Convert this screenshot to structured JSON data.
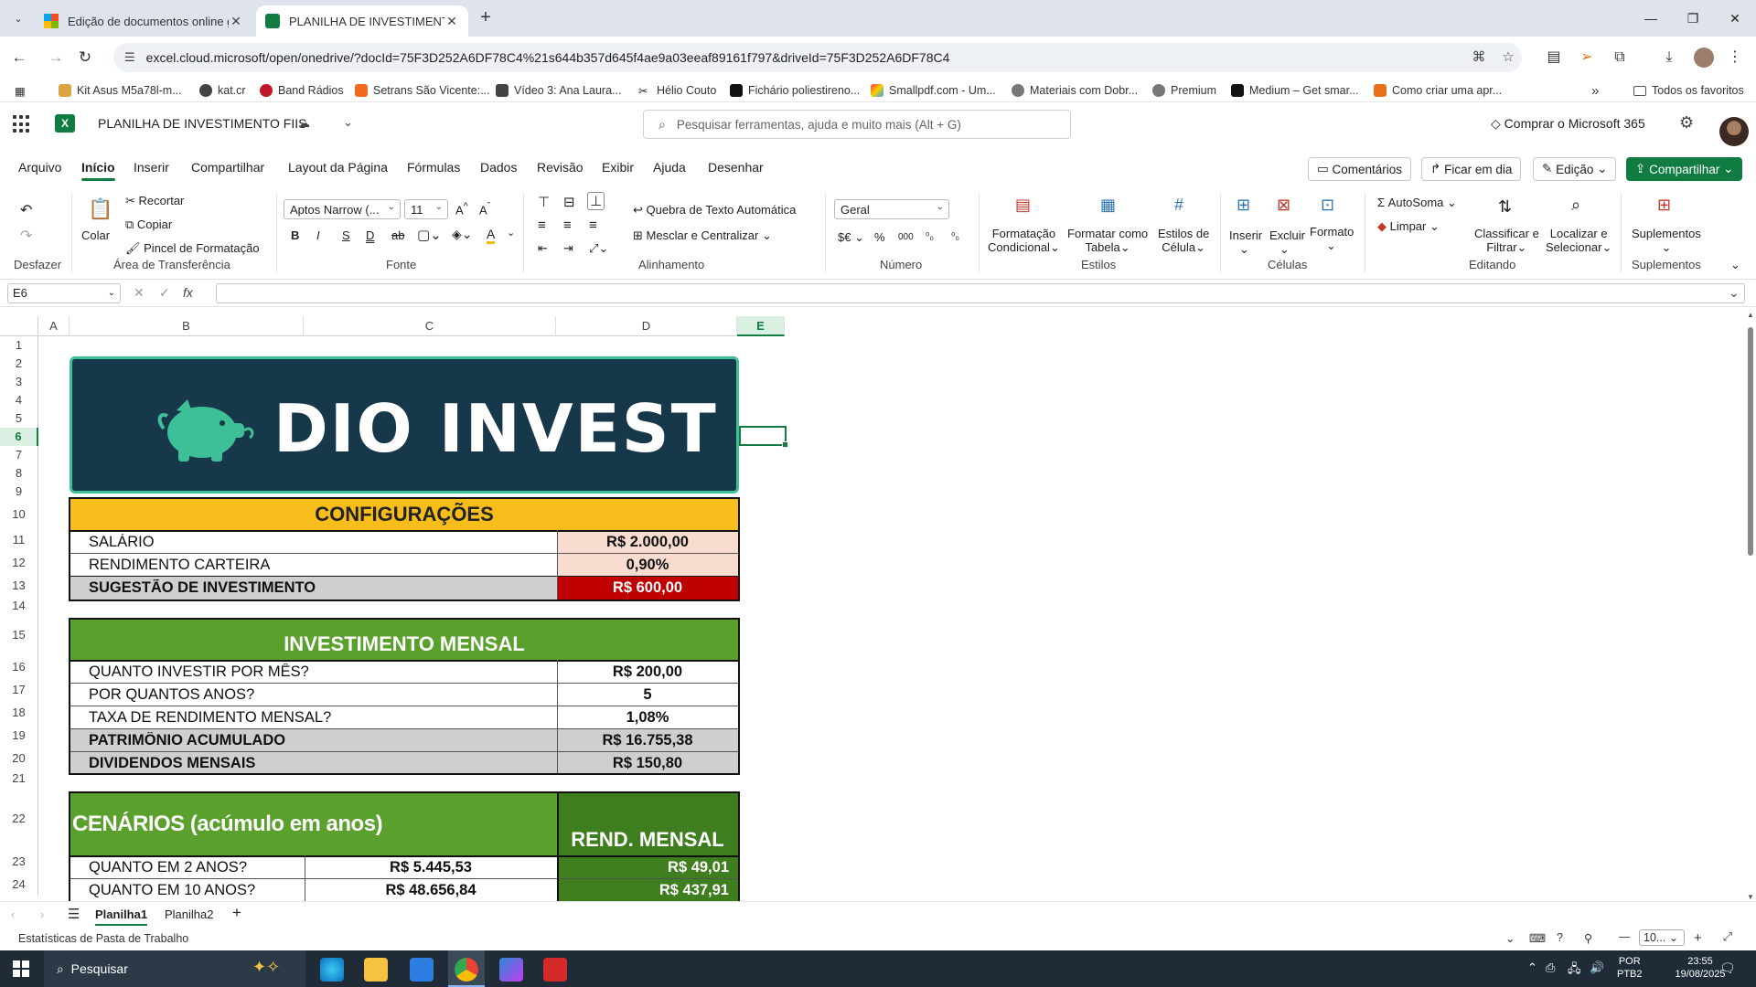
{
  "browser": {
    "tabs": [
      {
        "title": "Edição de documentos online g",
        "active": false
      },
      {
        "title": "PLANILHA DE INVESTIMENTO F",
        "active": true
      }
    ],
    "url": "excel.cloud.microsoft/open/onedrive/?docId=75F3D252A6DF78C4%21s644b357d645f4ae9a03eeaf89161f797&driveId=75F3D252A6DF78C4",
    "bookmarks": [
      "Kit Asus M5a78l-m...",
      "kat.cr",
      "Band Rádios",
      "Setrans São Vicente:...",
      "Vídeo 3: Ana Laura...",
      "Hélio Couto",
      "Fichário poliestireno...",
      "Smallpdf.com - Um...",
      "Materiais com Dobr...",
      "Premium",
      "Medium – Get smar...",
      "Como criar uma apr..."
    ],
    "bookmarks_more": "»",
    "all_favorites": "Todos os favoritos"
  },
  "excel": {
    "doc_title": "PLANILHA DE INVESTIMENTO FIIS",
    "search_placeholder": "Pesquisar ferramentas, ajuda e muito mais (Alt + G)",
    "buy": "Comprar o Microsoft 365",
    "ribbon_tabs": [
      "Arquivo",
      "Início",
      "Inserir",
      "Compartilhar",
      "Layout da Página",
      "Fórmulas",
      "Dados",
      "Revisão",
      "Exibir",
      "Ajuda",
      "Desenhar"
    ],
    "right_buttons": {
      "comments": "Comentários",
      "meeting": "Ficar em dia",
      "editing": "Edição",
      "share": "Compartilhar"
    },
    "ribbon": {
      "undo_group": "Desfazer",
      "paste": "Colar",
      "cut": "Recortar",
      "copy": "Copiar",
      "format_painter": "Pincel de Formatação",
      "clipboard_group": "Área de Transferência",
      "font_name": "Aptos Narrow (...",
      "font_size": "11",
      "font_group": "Fonte",
      "wrap": "Quebra de Texto Automática",
      "merge": "Mesclar e Centralizar",
      "align_group": "Alinhamento",
      "num_format": "Geral",
      "number_group": "Número",
      "cond_format": "Formatação",
      "cond_format2": "Condicional",
      "fmt_table": "Formatar como",
      "fmt_table2": "Tabela",
      "cell_styles": "Estilos de",
      "cell_styles2": "Célula",
      "styles_group": "Estilos",
      "insert": "Inserir",
      "delete": "Excluir",
      "format": "Formato",
      "cells_group": "Células",
      "autosum": "AutoSoma",
      "clear": "Limpar",
      "sort": "Classificar e",
      "sort2": "Filtrar",
      "find": "Localizar e",
      "find2": "Selecionar",
      "editing_group": "Editando",
      "addins": "Suplementos",
      "addins_group": "Suplementos"
    },
    "name_box": "E6",
    "columns": [
      "A",
      "B",
      "C",
      "D",
      "E"
    ],
    "selected_column": "E",
    "rows": [
      "1",
      "2",
      "3",
      "4",
      "5",
      "6",
      "7",
      "8",
      "9",
      "10",
      "11",
      "12",
      "13",
      "14",
      "15",
      "16",
      "17",
      "18",
      "19",
      "20",
      "21",
      "22",
      "23",
      "24"
    ],
    "selected_row": "6",
    "banner_title": "DIO INVEST",
    "config": {
      "header": "CONFIGURAÇÕES",
      "rows": [
        {
          "label": "SALÁRIO",
          "value": "R$ 2.000,00"
        },
        {
          "label": "RENDIMENTO CARTEIRA",
          "value": "0,90%"
        },
        {
          "label": "SUGESTÃO DE INVESTIMENTO",
          "value": "R$ 600,00"
        }
      ]
    },
    "monthly": {
      "header": "INVESTIMENTO MENSAL",
      "rows": [
        {
          "label": "QUANTO INVESTIR POR MÊS?",
          "value": "R$ 200,00"
        },
        {
          "label": "POR QUANTOS ANOS?",
          "value": "5"
        },
        {
          "label": "TAXA DE RENDIMENTO MENSAL?",
          "value": "1,08%"
        },
        {
          "label": "PATRIMÔNIO ACUMULADO",
          "value": "R$ 16.755,38"
        },
        {
          "label": "DIVIDENDOS MENSAIS",
          "value": "R$ 150,80"
        }
      ]
    },
    "scenarios": {
      "header": "CENÁRIOS (acúmulo em anos)",
      "header_right": "REND. MENSAL",
      "rows": [
        {
          "label": "QUANTO EM 2 ANOS?",
          "value": "R$ 5.445,53",
          "monthly": "R$ 49,01"
        },
        {
          "label": "QUANTO EM 10 ANOS?",
          "value": "R$ 48.656,84",
          "monthly": "R$ 437,91"
        }
      ]
    },
    "sheets": [
      "Planilha1",
      "Planilha2"
    ],
    "active_sheet": "Planilha1",
    "status_text": "Estatísticas de Pasta de Trabalho",
    "zoom": "10..."
  },
  "taskbar": {
    "search": "Pesquisar",
    "lang": "POR",
    "lang2": "PTB2",
    "time": "23:55",
    "date": "19/08/2025"
  },
  "colors": {
    "excel_green": "#107c41",
    "banner_bg": "#17384a",
    "banner_border": "#3dbf98",
    "config_header": "#f6bd1b",
    "config_value": "#f9dcd0",
    "suggestion_red": "#c00000",
    "green_header": "#5aa02c",
    "dark_green": "#3f7e1f",
    "grey_row": "#cfcfcf"
  }
}
